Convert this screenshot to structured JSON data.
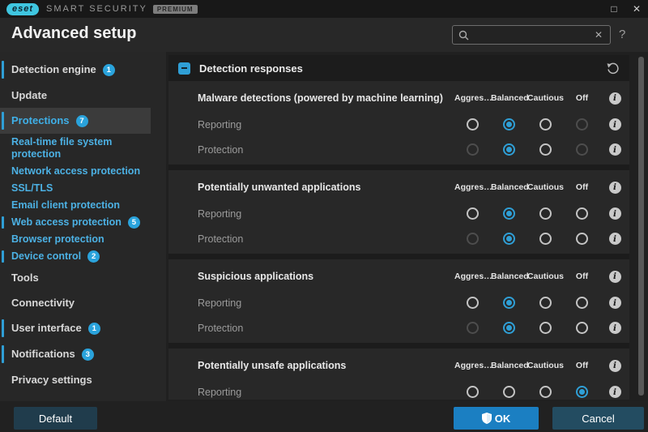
{
  "titlebar": {
    "brand": "eset",
    "product": "SMART SECURITY",
    "edition": "PREMIUM",
    "maximize": "□",
    "close": "✕"
  },
  "header": {
    "title": "Advanced setup",
    "search_value": "",
    "search_clear": "✕",
    "help": "?"
  },
  "sidebar": {
    "items": [
      {
        "label": "Detection engine",
        "badge": "1"
      },
      {
        "label": "Update"
      },
      {
        "label": "Protections",
        "badge": "7"
      },
      {
        "label": "Real-time file system protection"
      },
      {
        "label": "Network access protection"
      },
      {
        "label": "SSL/TLS"
      },
      {
        "label": "Email client protection"
      },
      {
        "label": "Web access protection",
        "badge": "5"
      },
      {
        "label": "Browser protection"
      },
      {
        "label": "Device control",
        "badge": "2"
      },
      {
        "label": "Tools"
      },
      {
        "label": "Connectivity"
      },
      {
        "label": "User interface",
        "badge": "1"
      },
      {
        "label": "Notifications",
        "badge": "3"
      },
      {
        "label": "Privacy settings"
      }
    ]
  },
  "main": {
    "panel_title": "Detection responses",
    "columns": [
      "Aggres…",
      "Balanced",
      "Cautious",
      "Off"
    ],
    "sections": [
      {
        "title": "Malware detections (powered by machine learning)",
        "rows": [
          {
            "label": "Reporting",
            "states": [
              "normal",
              "selected",
              "normal",
              "disabled"
            ]
          },
          {
            "label": "Protection",
            "states": [
              "disabled",
              "selected",
              "normal",
              "disabled"
            ]
          }
        ]
      },
      {
        "title": "Potentially unwanted applications",
        "rows": [
          {
            "label": "Reporting",
            "states": [
              "normal",
              "selected",
              "normal",
              "normal"
            ]
          },
          {
            "label": "Protection",
            "states": [
              "disabled",
              "selected",
              "normal",
              "normal"
            ]
          }
        ]
      },
      {
        "title": "Suspicious applications",
        "rows": [
          {
            "label": "Reporting",
            "states": [
              "normal",
              "selected",
              "normal",
              "normal"
            ]
          },
          {
            "label": "Protection",
            "states": [
              "disabled",
              "selected",
              "normal",
              "normal"
            ]
          }
        ]
      },
      {
        "title": "Potentially unsafe applications",
        "rows": [
          {
            "label": "Reporting",
            "states": [
              "normal",
              "normal",
              "normal",
              "selected"
            ]
          }
        ]
      }
    ],
    "info_glyph": "i"
  },
  "footer": {
    "default_label": "Default",
    "ok_label": "OK",
    "cancel_label": "Cancel"
  },
  "colors": {
    "accent_blue": "#2f9fd6",
    "link_blue": "#4cb1e4",
    "ok_button_blue": "#1b7fc2",
    "logo_cyan": "#3fc6e0",
    "panel_bg": "#1c1c1c",
    "section_bg": "#282828",
    "window_bg": "#272727"
  }
}
